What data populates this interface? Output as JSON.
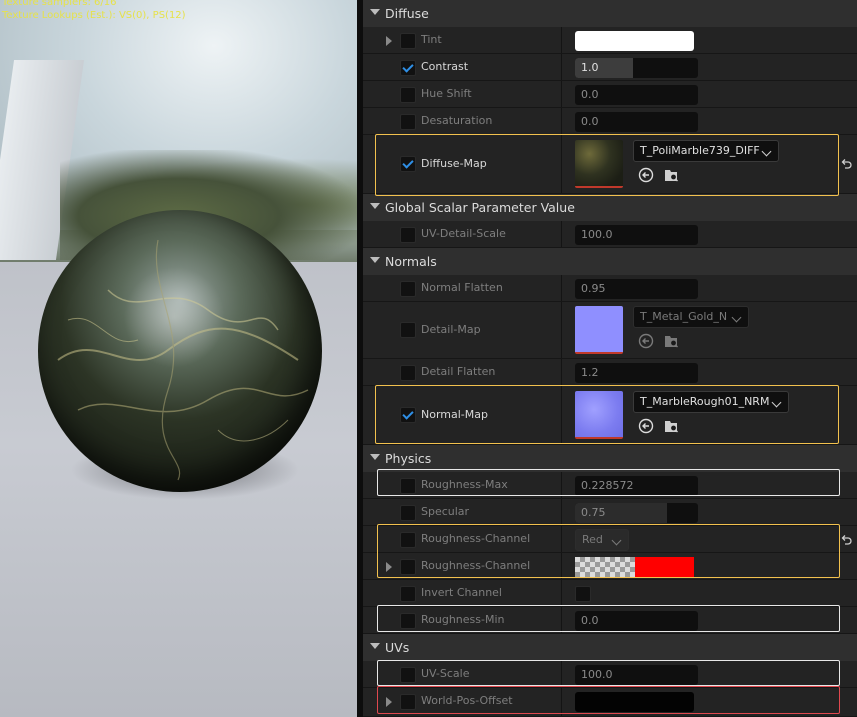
{
  "viewport": {
    "stats_line1": "Texture samplers: 6/16",
    "stats_line2": "Texture Lookups (Est.): VS(0), PS(12)"
  },
  "categories": {
    "diffuse": "Diffuse",
    "global_scalar": "Global Scalar Parameter Value",
    "normals": "Normals",
    "physics": "Physics",
    "uvs": "UVs"
  },
  "rows": {
    "tint": {
      "label": "Tint",
      "enabled": false,
      "color": "#ffffff"
    },
    "contrast": {
      "label": "Contrast",
      "enabled": true,
      "value": "1.0",
      "fill": 0.45
    },
    "hue_shift": {
      "label": "Hue Shift",
      "enabled": false,
      "value": "0.0"
    },
    "desaturation": {
      "label": "Desaturation",
      "enabled": false,
      "value": "0.0"
    },
    "diffuse_map": {
      "label": "Diffuse-Map",
      "enabled": true,
      "texture": "T_PoliMarble739_DIFF"
    },
    "uv_detail_scale": {
      "label": "UV-Detail-Scale",
      "enabled": false,
      "value": "100.0"
    },
    "normal_flatten": {
      "label": "Normal Flatten",
      "enabled": false,
      "value": "0.95"
    },
    "detail_map": {
      "label": "Detail-Map",
      "enabled": false,
      "texture": "T_Metal_Gold_N"
    },
    "detail_flatten": {
      "label": "Detail Flatten",
      "enabled": false,
      "value": "1.2"
    },
    "normal_map": {
      "label": "Normal-Map",
      "enabled": true,
      "texture": "T_MarbleRough01_NRM"
    },
    "roughness_max": {
      "label": "Roughness-Max",
      "enabled": false,
      "value": "0.228572"
    },
    "specular": {
      "label": "Specular",
      "enabled": false,
      "value": "0.75",
      "fill": 0.75
    },
    "roughness_channel_1": {
      "label": "Roughness-Channel",
      "enabled": false,
      "value": "Red"
    },
    "roughness_channel_2": {
      "label": "Roughness-Channel",
      "enabled": false,
      "color": "#ff0000"
    },
    "invert_channel": {
      "label": "Invert Channel",
      "enabled": false,
      "checked": false
    },
    "roughness_min": {
      "label": "Roughness-Min",
      "enabled": false,
      "value": "0.0"
    },
    "uv_scale": {
      "label": "UV-Scale",
      "enabled": false,
      "value": "100.0"
    },
    "world_pos_offset": {
      "label": "World-Pos-Offset",
      "enabled": false,
      "color": "#030303"
    }
  },
  "colors": {
    "highlight_yellow": "#f2c14e",
    "highlight_white": "#e8e8e8",
    "highlight_red": "#e0484f",
    "checkbox_check": "#2f8fe6"
  },
  "icons": [
    "use-selected-asset-icon",
    "browse-asset-icon",
    "reset-to-default-icon",
    "chevron-down-icon",
    "expand-arrow-icon"
  ]
}
